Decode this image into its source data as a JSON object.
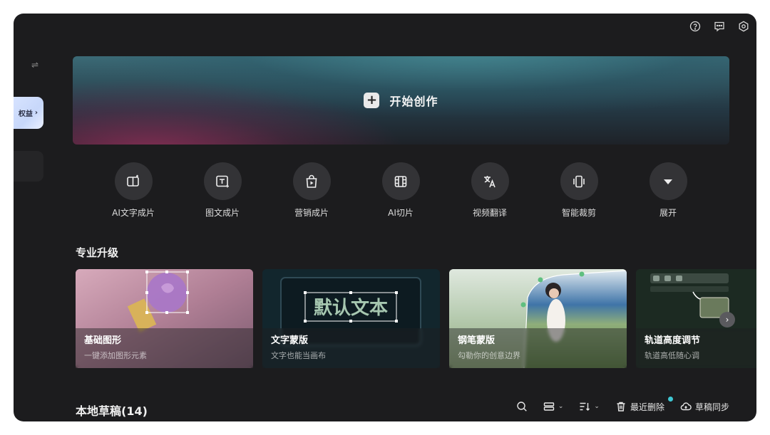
{
  "header": {
    "icons": [
      "help-icon",
      "feedback-icon",
      "settings-icon"
    ]
  },
  "sidebar": {
    "swap_icon": "⇌",
    "vip_label": "权益",
    "vip_chevron": "›"
  },
  "hero": {
    "label": "开始创作",
    "plus": "+"
  },
  "tools": [
    {
      "label": "AI文字成片",
      "icon": "ai-text-video-icon"
    },
    {
      "label": "图文成片",
      "icon": "image-text-video-icon"
    },
    {
      "label": "营销成片",
      "icon": "marketing-video-icon"
    },
    {
      "label": "AI切片",
      "icon": "ai-clip-icon"
    },
    {
      "label": "视频翻译",
      "icon": "translate-icon"
    },
    {
      "label": "智能裁剪",
      "icon": "smart-crop-icon"
    },
    {
      "label": "展开",
      "icon": "expand-icon"
    }
  ],
  "section": {
    "title": "专业升级"
  },
  "cards": [
    {
      "title": "基础图形",
      "subtitle": "一键添加图形元素"
    },
    {
      "title": "文字蒙版",
      "subtitle": "文字也能当画布",
      "art_text": "默认文本"
    },
    {
      "title": "钢笔蒙版",
      "subtitle": "勾勒你的创意边界"
    },
    {
      "title": "轨道高度调节",
      "subtitle": "轨道高低随心调"
    }
  ],
  "next_chevron": "›",
  "drafts": {
    "title": "本地草稿(14)",
    "recent_delete": "最近删除",
    "sync": "草稿同步",
    "caret": "⌄"
  },
  "colors": {
    "background": "#1c1c1e",
    "tool_circle": "#333336",
    "notify_dot": "#3fc7d3"
  }
}
